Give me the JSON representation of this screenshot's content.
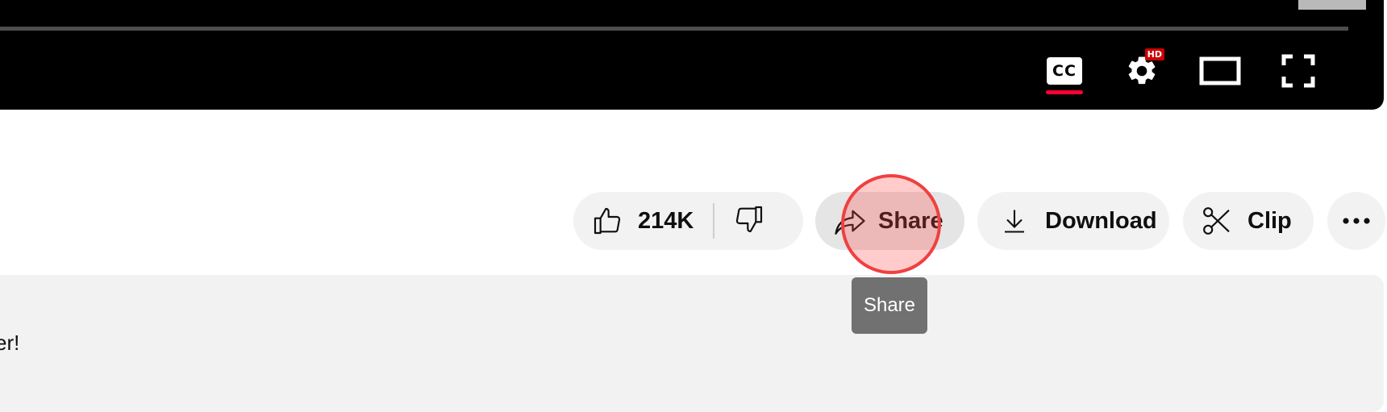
{
  "player": {
    "controls": {
      "captions_label": "CC",
      "settings_badge": "HD"
    }
  },
  "actions": {
    "like_count": "214K",
    "share_label": "Share",
    "download_label": "Download",
    "clip_label": "Clip"
  },
  "tooltip": {
    "text": "Share"
  },
  "description": {
    "visible_text": "er!"
  },
  "colors": {
    "accent_red": "#ff0033",
    "player_bg": "#000000",
    "pill_bg": "#f2f2f2",
    "pill_hover_bg": "#e5e5e5",
    "tooltip_bg": "#717171"
  },
  "icons": {
    "like": "thumbs-up-icon",
    "dislike": "thumbs-down-icon",
    "share": "share-arrow-icon",
    "download": "download-icon",
    "clip": "scissors-icon",
    "more": "more-horizontal-icon",
    "settings": "gear-icon",
    "theater": "theater-mode-icon",
    "fullscreen": "fullscreen-icon"
  }
}
